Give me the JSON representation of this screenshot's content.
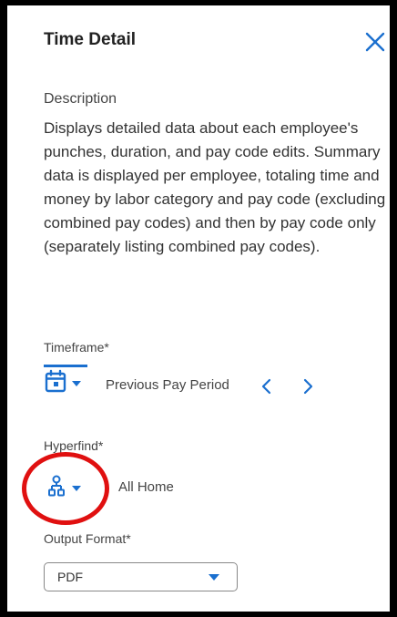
{
  "panel": {
    "title": "Time Detail",
    "close_icon": "close-icon"
  },
  "description": {
    "label": "Description",
    "text": "Displays detailed data about each employee's punches, duration, and pay code edits. Summary data is displayed per employee, totaling time and money by labor category and pay code (excluding combined pay codes) and then by pay code only (separately listing combined pay codes)."
  },
  "timeframe": {
    "label": "Timeframe*",
    "value": "Previous Pay Period",
    "icon": "calendar-icon",
    "prev_icon": "chevron-left-icon",
    "next_icon": "chevron-right-icon"
  },
  "hyperfind": {
    "label": "Hyperfind*",
    "value": "All Home",
    "icon": "hierarchy-icon"
  },
  "output_format": {
    "label": "Output Format*",
    "value": "PDF"
  },
  "colors": {
    "accent": "#1a6fcf",
    "highlight_circle": "#e01010",
    "frame": "#000000"
  }
}
